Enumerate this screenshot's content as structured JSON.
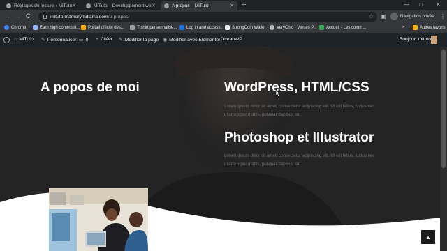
{
  "browser": {
    "tabs": [
      {
        "title": "Réglages de lecture ‹ MiTuto — ",
        "active": false
      },
      {
        "title": "MiTuto – Développement web",
        "active": false
      },
      {
        "title": "A propos – MiTuto",
        "active": true
      }
    ],
    "new_tab": "+",
    "window_controls": {
      "minimize": "—",
      "maximize": "□",
      "close": "✕"
    },
    "nav": {
      "back": "←",
      "forward": "→",
      "reload": "C"
    },
    "address": {
      "host": "mituto.mamarymdiarra.com",
      "path": "/a-propos/"
    },
    "profile_label": "Navigation privée",
    "menu": "⋮",
    "bookmarks": [
      {
        "label": "Chrome",
        "color": "#4285f4"
      },
      {
        "label": "Earn high commissi...",
        "color": "#8ab4f8"
      },
      {
        "label": "Portail officiel des...",
        "color": "#f9ab00"
      },
      {
        "label": "T-shirt personnalisé...",
        "color": "#9aa0a6"
      },
      {
        "label": "Log in and access...",
        "color": "#1a73e8"
      },
      {
        "label": "StrongCoin Wallet",
        "color": "#e8eaed"
      },
      {
        "label": "VeryChic - Ventes P...",
        "color": "#bdc1c6"
      },
      {
        "label": "Accueil - Les comm...",
        "color": "#34a853"
      }
    ],
    "bookmarks_more": "»",
    "other_bookmarks": "Autres favoris"
  },
  "wp_admin_bar": {
    "site": "MiTuto",
    "customize": "Personnaliser",
    "comments": "0",
    "new": "Créer",
    "edit": "Modifier la page",
    "elementor": "Modifier avec Elementor",
    "oceanwp": "OceanWP",
    "greeting": "Bonjour, mituto"
  },
  "page": {
    "left_heading": "A popos de moi",
    "sections": [
      {
        "title": "WordPress, HTML/CSS",
        "line1": "Lorem ipsum dolor sit amet, consectetur adipiscing elit. Ut elit tellus, luctus nec",
        "line2": "ullamcorper mattis, pulvinar dapibus leo."
      },
      {
        "title": "Photoshop et Illustrator",
        "line1": "Lorem ipsum dolor sit amet, consectetur adipiscing elit. Ut elit tellus, luctus nec",
        "line2": "ullamcorper mattis, pulvinar dapibus leo."
      }
    ],
    "scroll_top_icon": "▲"
  },
  "colors": {
    "accent_white": "#ffffff",
    "hero_bg": "#232323",
    "lorem_text": "#6e6e6e",
    "wp_bar": "#1d2327"
  }
}
